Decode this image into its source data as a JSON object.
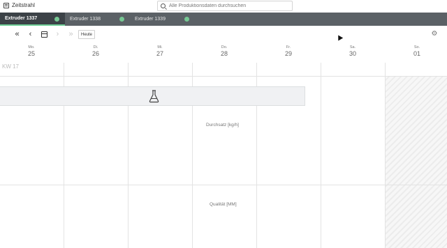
{
  "app": {
    "title": "Zeitstrahl"
  },
  "search": {
    "placeholder": "Alle Produktionsdaten durchsuchen"
  },
  "tabs": [
    {
      "label": "Extruder 1337",
      "active": true,
      "status_color": "#76c893"
    },
    {
      "label": "Extruder 1338",
      "active": false,
      "status_color": "#76c893"
    },
    {
      "label": "Extruder 1339",
      "active": false,
      "status_color": "#76c893"
    }
  ],
  "toolbar": {
    "first_icon": "«",
    "prev_icon": "‹",
    "next_icon": "›",
    "last_icon": "»",
    "today_label": "Heute"
  },
  "week_label": "KW 17",
  "days": [
    {
      "weekday": "Mo.",
      "date": "25"
    },
    {
      "weekday": "Di.",
      "date": "26"
    },
    {
      "weekday": "Mi.",
      "date": "27"
    },
    {
      "weekday": "Do.",
      "date": "28"
    },
    {
      "weekday": "Fr.",
      "date": "29"
    },
    {
      "weekday": "Sa.",
      "date": "30"
    },
    {
      "weekday": "So.",
      "date": "01"
    }
  ],
  "metrics": {
    "throughput": "Durchsatz [kg/h]",
    "quality": "Qualität [MM]"
  },
  "colors": {
    "tabbar_bg": "#5b6166",
    "active_tab_bg": "#3c4247",
    "status_green": "#76c893"
  }
}
